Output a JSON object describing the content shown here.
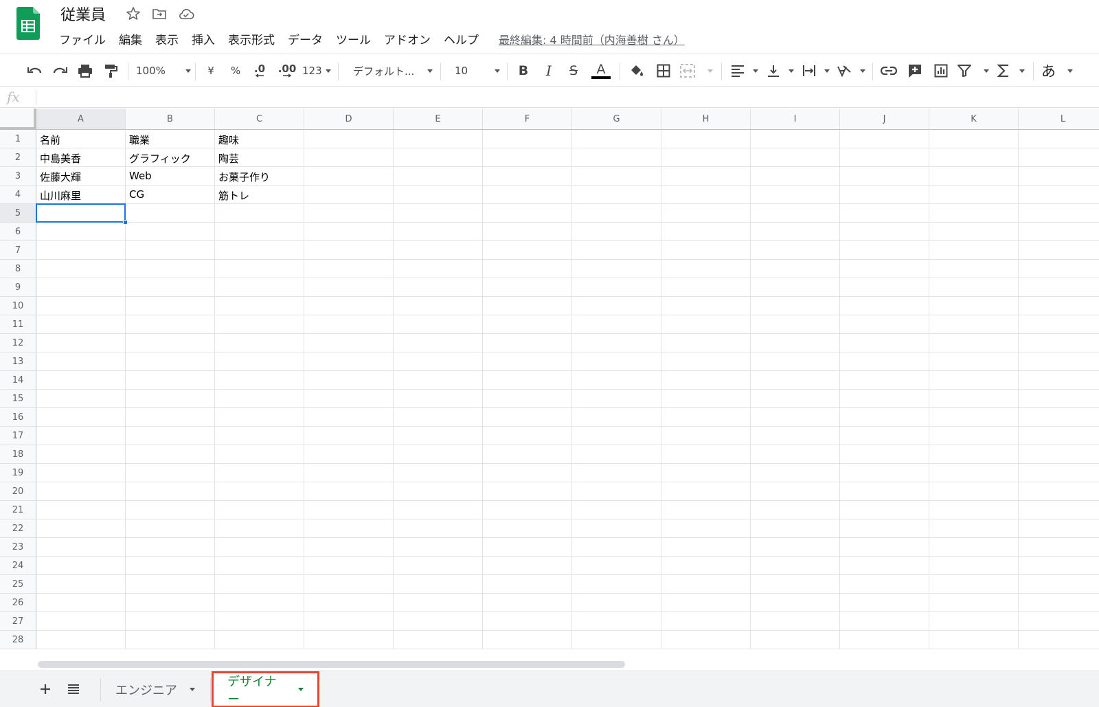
{
  "header": {
    "title": "従業員",
    "menu": [
      "ファイル",
      "編集",
      "表示",
      "挿入",
      "表示形式",
      "データ",
      "ツール",
      "アドオン",
      "ヘルプ"
    ],
    "last_edit": "最終編集: 4 時間前（内海善樹 さん）"
  },
  "toolbar": {
    "zoom": "100%",
    "currency": "¥",
    "percent": "%",
    "decrease_decimal": ".0",
    "increase_decimal": ".00",
    "number_format": "123",
    "font": "デフォルト...",
    "font_size": "10",
    "bold": "B",
    "italic": "I",
    "strike": "S",
    "text_color": "A",
    "input_tools": "あ"
  },
  "formula_bar": {
    "fx_label": "fx",
    "value": ""
  },
  "grid": {
    "columns": [
      "A",
      "B",
      "C",
      "D",
      "E",
      "F",
      "G",
      "H",
      "I",
      "J",
      "K",
      "L"
    ],
    "rows": [
      "1",
      "2",
      "3",
      "4",
      "5",
      "6",
      "7",
      "8",
      "9",
      "10",
      "11",
      "12",
      "13",
      "14",
      "15",
      "16",
      "17",
      "18",
      "19",
      "20",
      "21",
      "22",
      "23",
      "24",
      "25",
      "26",
      "27",
      "28"
    ],
    "cells": [
      [
        "名前",
        "職業",
        "趣味"
      ],
      [
        "中島美香",
        "グラフィック",
        "陶芸"
      ],
      [
        "佐藤大輝",
        "Web",
        "お菓子作り"
      ],
      [
        "山川麻里",
        "CG",
        "筋トレ"
      ]
    ],
    "selected_cell": "A5"
  },
  "sheets": [
    {
      "name": "エンジニア",
      "active": false
    },
    {
      "name": "デザイナー",
      "active": true
    }
  ],
  "colors": {
    "sheets_green": "#0f9d58",
    "selection_blue": "#1a73e8",
    "active_tab_text": "#188038",
    "highlight_border": "#e8452c"
  }
}
